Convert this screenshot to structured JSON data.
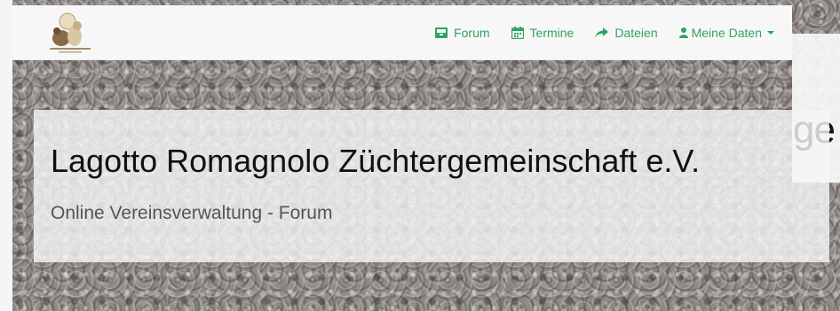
{
  "navbar": {
    "logo_icon": "lagotto-dogs-logo-icon",
    "items": [
      {
        "label": "Forum",
        "icon": "inbox-icon"
      },
      {
        "label": "Termine",
        "icon": "calendar-icon"
      },
      {
        "label": "Dateien",
        "icon": "share-arrow-icon"
      },
      {
        "label": "Meine Daten",
        "icon": "user-icon",
        "dropdown": true
      }
    ],
    "accent_color": "#2fa360"
  },
  "hero": {
    "title": "Lagotto Romagnolo Züchtergemeinschaft e.V.",
    "subtitle": "Online Vereinsverwaltung - Forum",
    "overflow_text": "ge"
  }
}
